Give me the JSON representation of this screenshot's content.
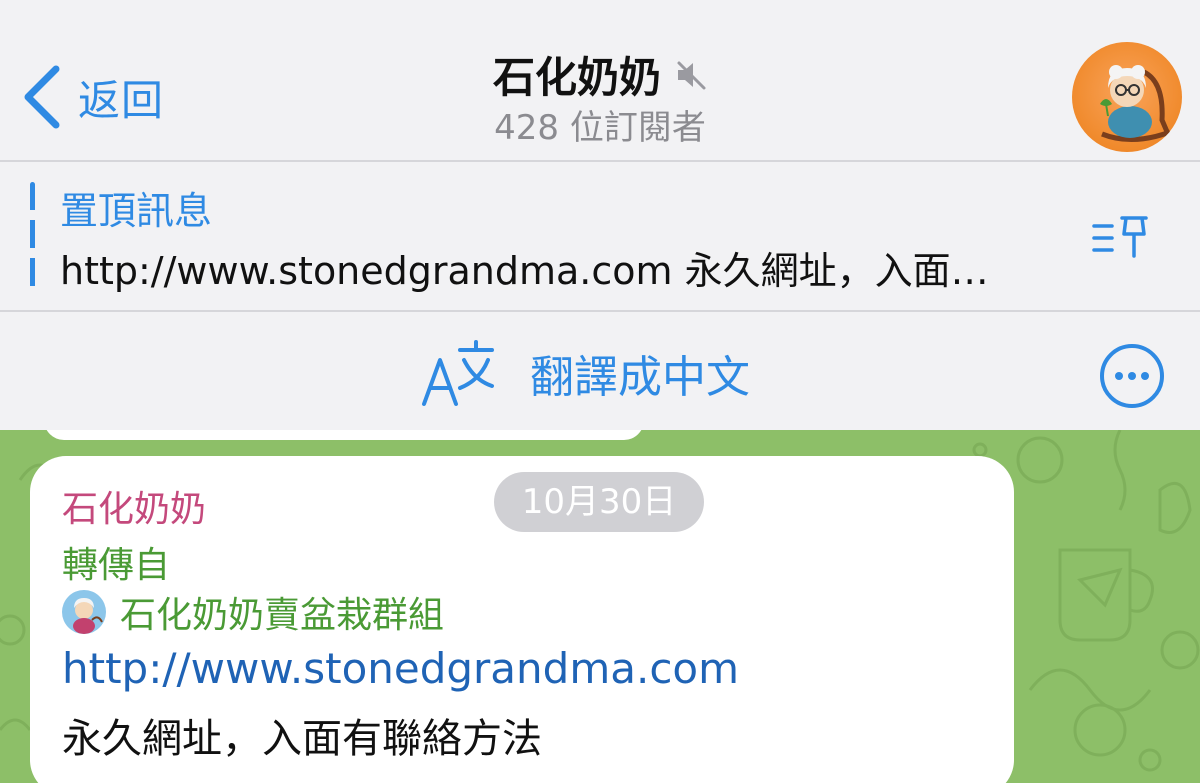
{
  "header": {
    "back_label": "返回",
    "title": "石化奶奶",
    "subtitle": "428 位訂閱者",
    "muted_icon": "speaker-muted-icon"
  },
  "pinned": {
    "title": "置頂訊息",
    "text": "http://www.stonedgrandma.com 永久網址，入面…"
  },
  "translate": {
    "label": "翻譯成中文"
  },
  "date_badge": "10月30日",
  "message": {
    "sender": "石化奶奶",
    "forwarded_label": "轉傳自",
    "forwarded_source": "石化奶奶賣盆栽群組",
    "link": "http://www.stonedgrandma.com",
    "text": "永久網址，入面有聯絡方法"
  },
  "colors": {
    "accent": "#2f8ae3",
    "sender": "#c4497c",
    "forward": "#4a9a35",
    "link": "#1f63b5",
    "chat_bg": "#8dbf68"
  }
}
